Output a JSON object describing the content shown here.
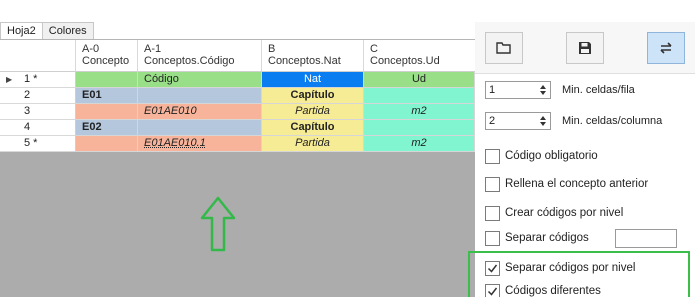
{
  "tabs": [
    "Hoja2",
    "Colores"
  ],
  "columns": [
    {
      "id": "A-0",
      "name": "Concepto"
    },
    {
      "id": "A-1",
      "name": "Conceptos.Código"
    },
    {
      "id": "B",
      "name": "Conceptos.Nat"
    },
    {
      "id": "C",
      "name": "Conceptos.Ud"
    }
  ],
  "rows": [
    {
      "label": "1 *",
      "cells": [
        "",
        "Código",
        "Nat",
        "Ud"
      ]
    },
    {
      "label": "2",
      "cells": [
        "E01",
        "",
        "Capítulo",
        ""
      ]
    },
    {
      "label": "3",
      "cells": [
        "",
        "E01AE010",
        "Partida",
        "m2"
      ]
    },
    {
      "label": "4",
      "cells": [
        "E02",
        "",
        "Capítulo",
        ""
      ]
    },
    {
      "label": "5 *",
      "cells": [
        "",
        "E01AE010.1",
        "Partida",
        "m2"
      ]
    }
  ],
  "colors": {
    "green": "#99df88",
    "blue": "#0a7ef0",
    "aqua": "#80f5d0",
    "steel": "#b5c7dc",
    "salmon": "#f7b49b",
    "yellow": "#f6ec95",
    "arrow": "#33b84a"
  },
  "panel": {
    "buttons": [
      {
        "icon": "folder-open-icon"
      },
      {
        "icon": "save-icon"
      },
      {
        "icon": "sync-icon"
      }
    ],
    "min_cells_row": {
      "value": "1",
      "label": "Min. celdas/fila"
    },
    "min_cells_col": {
      "value": "2",
      "label": "Min. celdas/columna"
    },
    "checks": [
      {
        "label": "Código obligatorio",
        "checked": false
      },
      {
        "label": "Rellena el concepto anterior",
        "checked": false
      },
      {
        "label": "Crear códigos por nivel",
        "checked": false
      },
      {
        "label": "Separar códigos",
        "checked": false
      },
      {
        "label": "Separar códigos por nivel",
        "checked": true
      },
      {
        "label": "Códigos diferentes",
        "checked": true
      }
    ],
    "separator_value": ""
  }
}
